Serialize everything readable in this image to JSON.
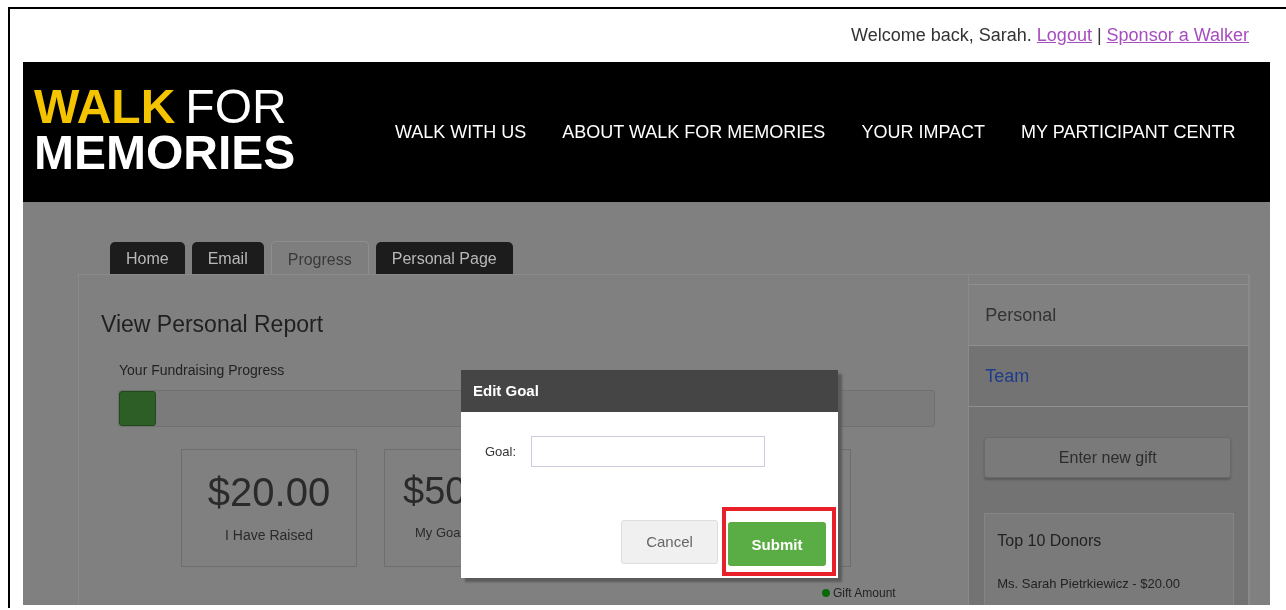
{
  "top_bar": {
    "greeting": "Welcome back, Sarah.",
    "links": [
      "Logout",
      "Sponsor a Walker"
    ],
    "separator": "|"
  },
  "logo": {
    "accent": "WALK",
    "rest": "FOR",
    "second_line": "MEMORIES"
  },
  "nav": [
    "WALK WITH US",
    "ABOUT WALK FOR MEMORIES",
    "YOUR IMPACT",
    "MY PARTICIPANT CENTR"
  ],
  "tabs": [
    {
      "label": "Home",
      "selected": false
    },
    {
      "label": "Email",
      "selected": false
    },
    {
      "label": "Progress",
      "selected": true
    },
    {
      "label": "Personal Page",
      "selected": false
    }
  ],
  "report": {
    "title": "View Personal Report",
    "progress_label": "Your Fundraising Progress",
    "level": 0.045,
    "stats": [
      {
        "kind": "figure",
        "value": "$20.00",
        "label": "I Have Raised"
      },
      {
        "kind": "figure",
        "value": "$50",
        "label": "My Goa"
      },
      {
        "kind": "blank"
      }
    ],
    "legend": "Gift Amount"
  },
  "sidebar": {
    "items": [
      {
        "label": "Personal",
        "selected": false
      },
      {
        "label": "Team",
        "selected": true
      }
    ],
    "button": "Enter new gift",
    "donors": {
      "title": "Top 10 Donors",
      "entries": [
        "Ms. Sarah Pietrkiewicz - $20.00"
      ]
    }
  },
  "dialog": {
    "title": "Edit Goal",
    "field_label": "Goal:",
    "buttons": [
      {
        "label": "Cancel",
        "kind": "secondary",
        "highlighted": false
      },
      {
        "label": "Submit",
        "kind": "primary",
        "highlighted": true
      }
    ]
  }
}
